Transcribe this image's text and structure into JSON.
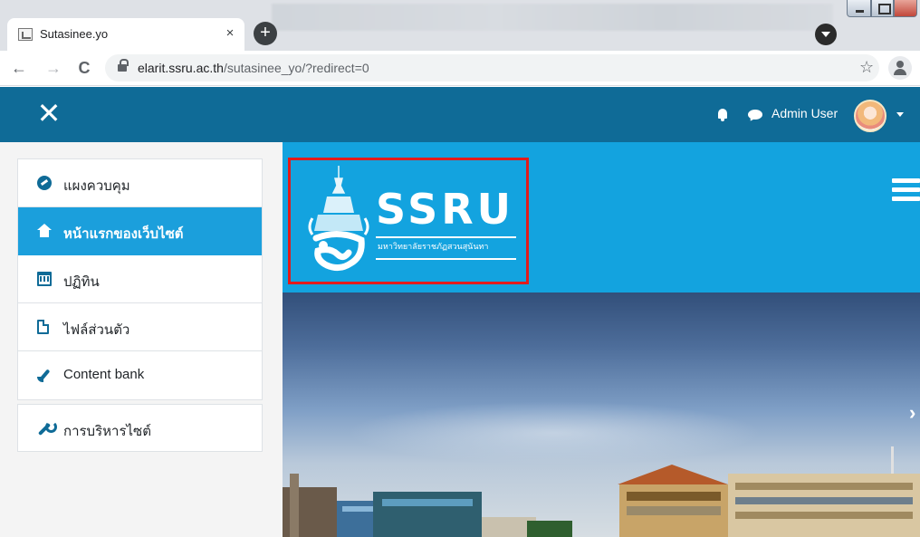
{
  "browser": {
    "tab_title": "Sutasinee.yo",
    "tab_close": "×",
    "new_tab": "+",
    "back": "←",
    "forward": "→",
    "reload": "C",
    "url_host": "elarit.ssru.ac.th",
    "url_path": "/sutasinee_yo/?redirect=0",
    "star": "☆"
  },
  "navbar": {
    "close_drawer": "✕",
    "user_name": "Admin User"
  },
  "drawer": {
    "items": [
      {
        "label": "แผงควบคุม",
        "icon": "dashboard-icon"
      },
      {
        "label": "หน้าแรกของเว็บไซต์",
        "icon": "home-icon",
        "active": true
      },
      {
        "label": "ปฏิทิน",
        "icon": "calendar-icon"
      },
      {
        "label": "ไฟล์ส่วนตัว",
        "icon": "file-icon"
      },
      {
        "label": "Content bank",
        "icon": "paint-brush-icon"
      }
    ],
    "admin_item": {
      "label": "การบริหารไซต์",
      "icon": "wrench-icon"
    }
  },
  "header": {
    "logo_text": "SSRU",
    "logo_subtitle": "มหาวิทยาลัยราชภัฏสวนสุนันทา"
  },
  "hero": {
    "next_arrow": "›"
  },
  "colors": {
    "navbar": "#0f6b97",
    "header_band": "#13a3df",
    "active_item": "#1b9fdc",
    "highlight_border": "#e21b1b"
  }
}
